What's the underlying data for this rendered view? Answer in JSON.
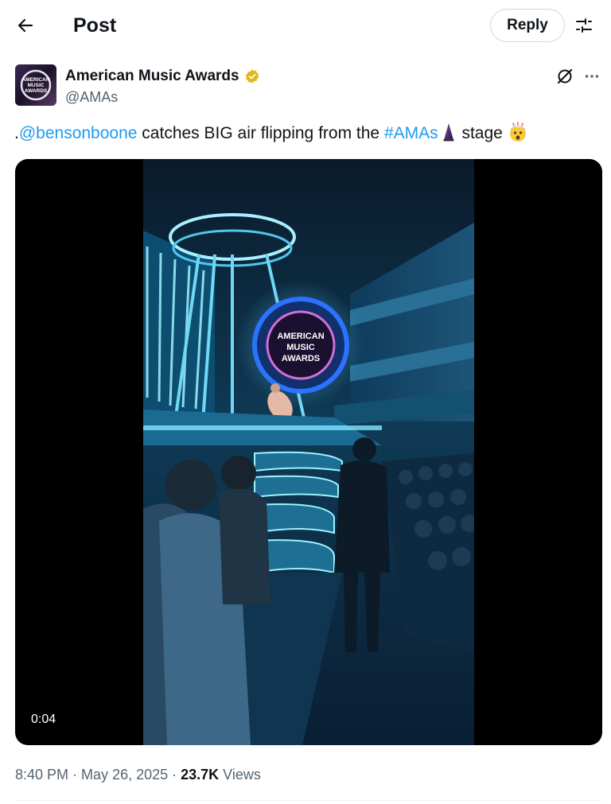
{
  "header": {
    "title": "Post",
    "reply_label": "Reply"
  },
  "author": {
    "name": "American Music Awards",
    "handle": "@AMAs",
    "avatar_text": [
      "AMERICAN",
      "MUSIC",
      "AWARDS"
    ],
    "verified": true,
    "verified_color": "#e2b719"
  },
  "tweet": {
    "prefix": ".",
    "mention": "@bensonboone",
    "text_1": " catches BIG air flipping from the ",
    "hashtag": "#AMAs",
    "text_2": " stage"
  },
  "media": {
    "type": "video",
    "duration": "0:04",
    "stage_sign": [
      "AMERICAN",
      "MUSIC",
      "AWARDS"
    ]
  },
  "meta": {
    "time": "8:40 PM",
    "sep1": " · ",
    "date": "May 26, 2025",
    "sep2": " · ",
    "views_count": "23.7K",
    "views_label": " Views"
  },
  "colors": {
    "link": "#1d9bf0",
    "text": "#0f1419",
    "secondary": "#536471",
    "border": "#cfd9de"
  },
  "icons": {
    "back": "arrow-left-icon",
    "filter": "sliders-icon",
    "grok": "grok-icon",
    "more": "more-horizontal-icon",
    "verified": "gold-verified-badge-icon",
    "hashflag": "amas-trophy-icon",
    "emoji": "exploding-head-emoji-icon"
  }
}
